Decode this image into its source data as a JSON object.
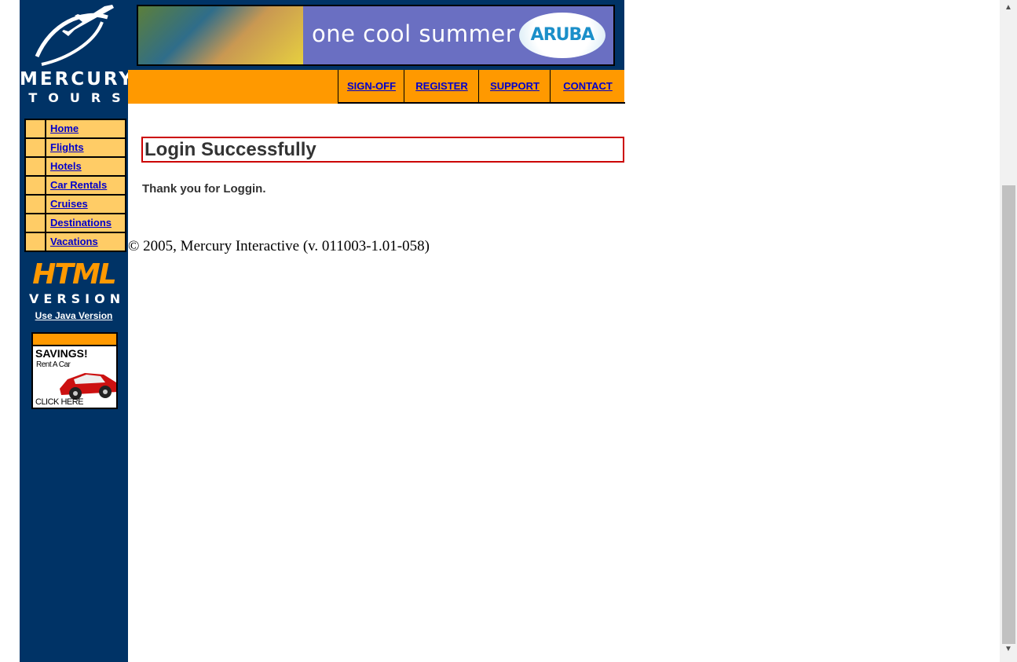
{
  "logo": {
    "line1": "MERCURY",
    "line2": "TOURS",
    "icon": "airplane-icon"
  },
  "banner": {
    "tagline": "one cool summer",
    "brand": "ARUBA"
  },
  "top_nav": [
    {
      "label": "SIGN-OFF"
    },
    {
      "label": "REGISTER"
    },
    {
      "label": "SUPPORT"
    },
    {
      "label": "CONTACT"
    }
  ],
  "side_menu": [
    {
      "label": "Home"
    },
    {
      "label": "Flights"
    },
    {
      "label": "Hotels"
    },
    {
      "label": "Car Rentals"
    },
    {
      "label": "Cruises"
    },
    {
      "label": "Destinations"
    },
    {
      "label": "Vacations"
    }
  ],
  "html_version": {
    "line1": "HTML",
    "line2": "VERSION",
    "link": "Use Java Version"
  },
  "savings_ad": {
    "title": "SAVINGS!",
    "subtitle": "Rent A Car",
    "cta": "CLICK HERE"
  },
  "main": {
    "heading": "Login Successfully",
    "message": "Thank you for Loggin.",
    "copyright": "© 2005, Mercury Interactive (v. 011003-1.01-058)"
  },
  "colors": {
    "navy": "#003366",
    "orange": "#ff9900",
    "menu_bg": "#ffcc66",
    "link": "#0000cc",
    "heading_border": "#cc0000"
  }
}
